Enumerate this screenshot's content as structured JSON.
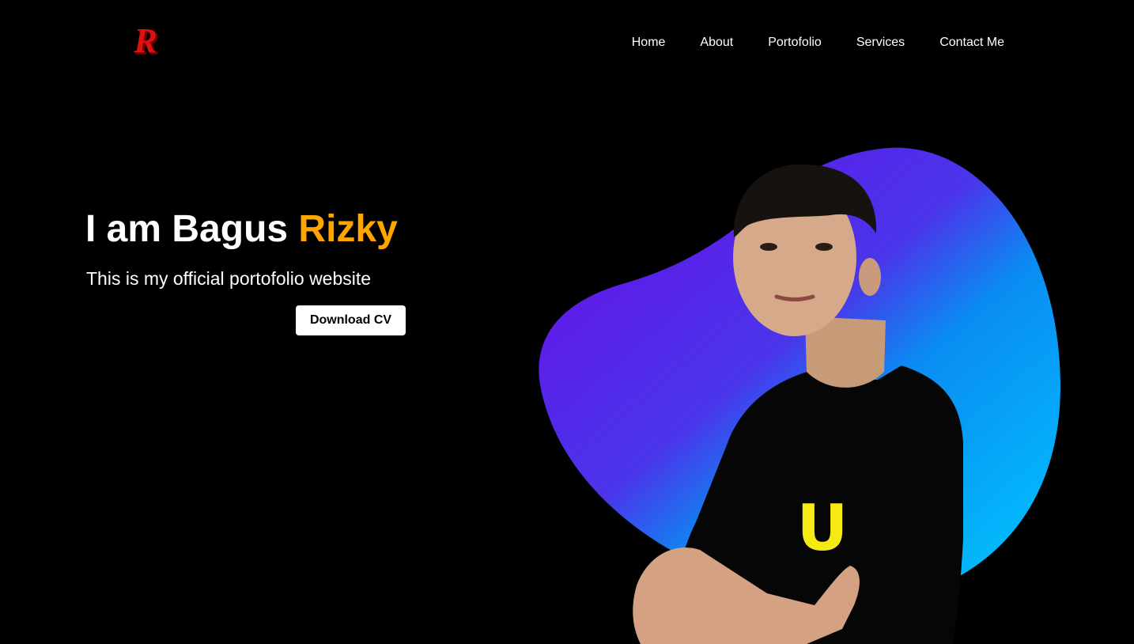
{
  "header": {
    "logo_letter": "R",
    "nav": [
      {
        "label": "Home"
      },
      {
        "label": "About"
      },
      {
        "label": "Portofolio"
      },
      {
        "label": "Services"
      },
      {
        "label": "Contact Me"
      }
    ]
  },
  "hero": {
    "title_prefix": "I am Bagus ",
    "title_accent": "Rizky",
    "subtitle": "This is my official portofolio website",
    "cta_label": "Download CV",
    "shirt_logo": "U"
  },
  "colors": {
    "background": "#000000",
    "accent": "#ffa500",
    "logo_red": "#e01010",
    "blob_start": "#6a0be8",
    "blob_end": "#00c8ff",
    "shirt_logo_yellow": "#f5ea14"
  },
  "icons": {
    "logo": "r-monogram-logo"
  }
}
